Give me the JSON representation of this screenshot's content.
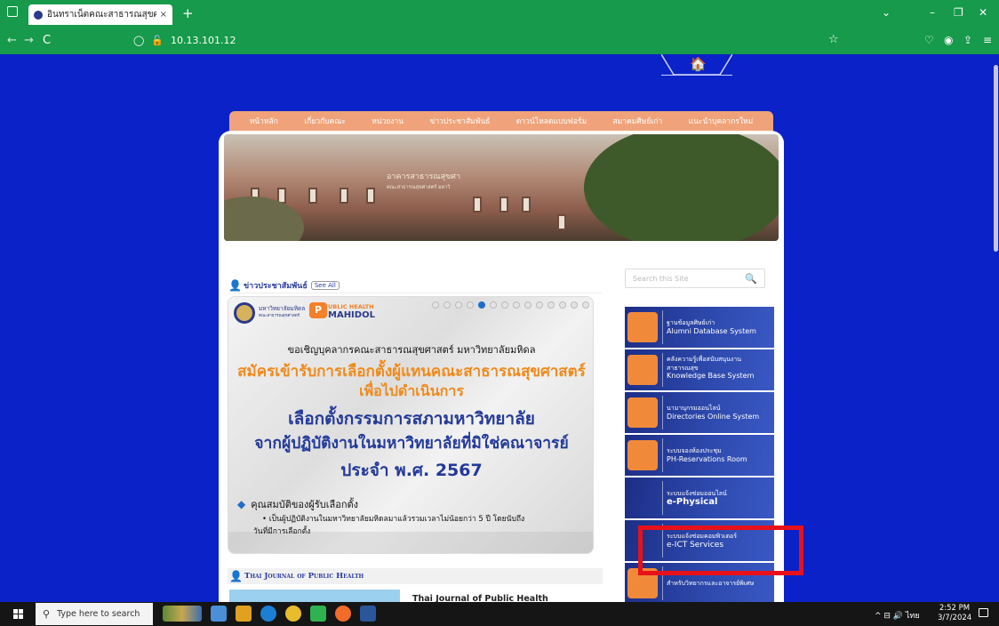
{
  "browser": {
    "tab_title": "อินทราเน็ตคณะสาธารณสุขศาสตร์",
    "tab_close": "×",
    "new_tab": "+",
    "url": "10.13.101.12",
    "back": "←",
    "forward": "→",
    "reload": "C",
    "star": "☆"
  },
  "site": {
    "home_icon": "🏠",
    "menu": [
      "หน้าหลัก",
      "เกี่ยวกับคณะ",
      "หน่วยงาน",
      "ข่าวประชาสัมพันธ์",
      "ดาวน์โหลดแบบฟอร์ม",
      "สมาคมศิษย์เก่า",
      "แนะนำบุคลากรใหม่"
    ],
    "banner_sign": "อาคารสาธารณสุขศา",
    "banner_sign_sub": "คณะสาธารณสุขศาสตร์ มหาวิ",
    "news_title": "ข่าวประชาสัมพันธ์",
    "see_all": "See All",
    "search_placeholder": "Search this Site",
    "slide": {
      "logo_text": "มหาวิทยาลัยมหิดล",
      "logo_sub": "คณะสาธารณสุขศาสตร์",
      "ph_letter": "P",
      "ph_line1": "UBLIC HEALTH",
      "ph_line2": "MAHIDOL",
      "line1": "ขอเชิญบุคลากรคณะสาธารณสุขศาสตร์ มหาวิทยาลัยมหิดล",
      "line2": "สมัครเข้ารับการเลือกตั้งผู้แทนคณะสาธารณสุขศาสตร์",
      "line3": "เพื่อไปดำเนินการ",
      "line4": "เลือกตั้งกรรมการสภามหาวิทยาลัย",
      "line5": "จากผู้ปฏิบัติงานในมหาวิทยาลัยที่มิใช่คณาจารย์",
      "line6": "ประจำ พ.ศ. 2567",
      "line7": "คุณสมบัติของผู้รับเลือกตั้ง",
      "line8": "• เป็นผู้ปฏิบัติงานในมหาวิทยาลัยมหิดลมาแล้วรวมเวลาไม่น้อยกว่า 5 ปี โดยนับถึง",
      "line9": "วันที่มีการเลือกตั้ง",
      "active_dot": 4
    },
    "journal_title": "Thai Journal of Public Health",
    "journal_text": "Thai Journal of Public Health",
    "links": [
      {
        "t1": "ฐานข้อมูลศิษย์เก่า",
        "t2": "Alumni Database System",
        "t3": ""
      },
      {
        "t1": "คลังความรู้เพื่อสนับสนุนงาน",
        "t2": "สาธารณสุข",
        "t3": "Knowledge Base System"
      },
      {
        "t1": "นามานุกรมออนไลน์",
        "t2": "Directories Online System",
        "t3": ""
      },
      {
        "t1": "ระบบจองห้องประชุม",
        "t2": "PH-Reservations Room",
        "t3": ""
      },
      {
        "t1": "ระบบแจ้งซ่อมออนไลน์",
        "t2": "e-Physical",
        "t3": ""
      },
      {
        "t1": "ระบบแจ้งซ่อมคอมพิวเตอร์",
        "t2": "e-ICT Services",
        "t3": ""
      },
      {
        "t1": "",
        "t2": "สำหรับวิทยากรและอาจารย์พิเศษ",
        "t3": ""
      }
    ]
  },
  "taskbar": {
    "search_placeholder": "Type here to search",
    "tray": "^ ⊟ 🔊 ไทย",
    "time": "2:52 PM",
    "date": "3/7/2024"
  },
  "colors": {
    "page_bg": "#0b22c8",
    "chrome": "#179a4b",
    "menu": "#f0a37a",
    "highlight_box": "#e8111a"
  }
}
